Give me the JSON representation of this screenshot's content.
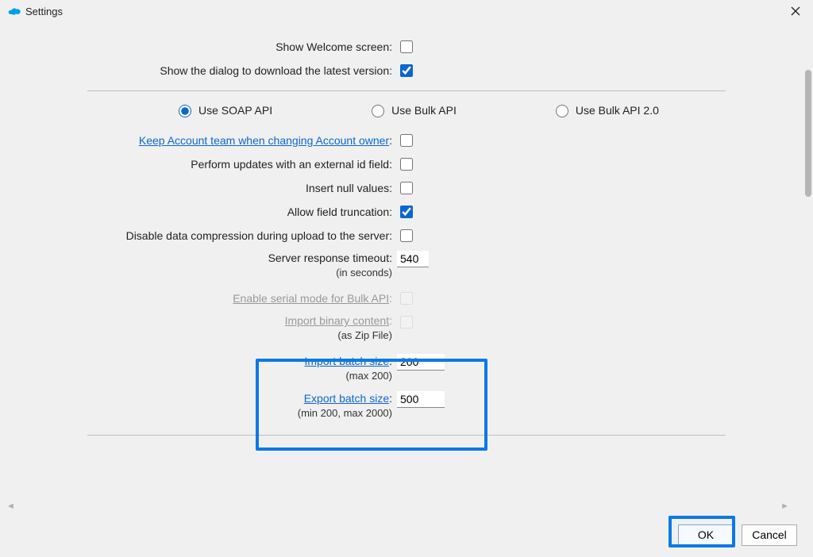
{
  "window": {
    "title": "Settings"
  },
  "general": {
    "show_welcome_label": "Show Welcome screen:",
    "show_download_label": "Show the dialog to download the latest version:"
  },
  "api": {
    "soap_label": "Use SOAP API",
    "bulk_label": "Use Bulk API",
    "bulk2_label": "Use Bulk API 2.0"
  },
  "options": {
    "keep_account_team": "Keep Account team when changing Account owner",
    "perform_updates_ext_id": "Perform updates with an external id field:",
    "insert_null_values": "Insert null values:",
    "allow_field_truncation": "Allow field truncation:",
    "disable_compression": "Disable data compression during upload to the server:",
    "server_response_timeout": "Server response timeout:",
    "server_response_timeout_sub": "(in seconds)",
    "server_response_timeout_value": "540",
    "enable_serial_bulk": "Enable serial mode for Bulk API",
    "import_binary_content": "Import binary content",
    "import_binary_content_sub": "(as Zip File)",
    "import_batch_size": "Import batch size",
    "import_batch_size_sub": "(max 200)",
    "import_batch_size_value": "200",
    "export_batch_size": "Export batch size",
    "export_batch_size_sub": "(min 200, max 2000)",
    "export_batch_size_value": "500"
  },
  "footer": {
    "ok": "OK",
    "cancel": "Cancel"
  }
}
